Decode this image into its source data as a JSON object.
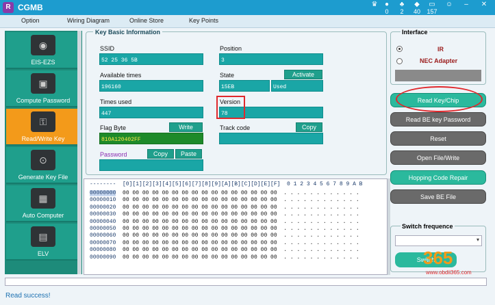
{
  "app": {
    "title": "CGMB",
    "logo_letter": "R"
  },
  "toolbar_icons": [
    {
      "name": "crown-icon",
      "glyph": "♛",
      "count": ""
    },
    {
      "name": "coin-icon",
      "glyph": "●",
      "count": "0"
    },
    {
      "name": "leaf-icon",
      "glyph": "♣",
      "count": "2"
    },
    {
      "name": "diamond-icon",
      "glyph": "◆",
      "count": "40"
    },
    {
      "name": "card-icon",
      "glyph": "▭",
      "count": "157"
    },
    {
      "name": "user-icon",
      "glyph": "☺",
      "count": ""
    },
    {
      "name": "minimize-icon",
      "glyph": "–",
      "count": ""
    },
    {
      "name": "close-icon",
      "glyph": "✕",
      "count": ""
    }
  ],
  "menu": [
    "Option",
    "Wiring Diagram",
    "Online Store",
    "Key Points"
  ],
  "sidebar": [
    {
      "label": "EIS-EZS",
      "icon": "ignition-icon",
      "glyph": "◉",
      "active": false
    },
    {
      "label": "Compute Password",
      "icon": "monitor-icon",
      "glyph": "▣",
      "active": false
    },
    {
      "label": "Read/Write Key",
      "icon": "car-key-icon",
      "glyph": "⚿",
      "active": true
    },
    {
      "label": "Generate Key File",
      "icon": "disc-icon",
      "glyph": "⊙",
      "active": false
    },
    {
      "label": "Auto Computer",
      "icon": "ecu-icon",
      "glyph": "▦",
      "active": false
    },
    {
      "label": "ELV",
      "icon": "elv-icon",
      "glyph": "▤",
      "active": false
    }
  ],
  "keyinfo": {
    "legend": "Key Basic Information",
    "ssid_label": "SSID",
    "ssid_value": "52 25 36 5B",
    "position_label": "Position",
    "position_value": "3",
    "avail_label": "Available times",
    "avail_value": "196160",
    "state_label": "State",
    "state_value": "15EB",
    "state_extra": "Used",
    "activate_label": "Activate",
    "used_label": "Times used",
    "used_value": "447",
    "version_label": "Version",
    "version_value": "78",
    "flag_label": "Flag Byte",
    "flag_value": "810A120402FF",
    "write_label": "Write",
    "track_label": "Track code",
    "track_value": "",
    "copy_label": "Copy",
    "password_label": "Password",
    "password_value": "",
    "pw_copy_label": "Copy",
    "paste_label": "Paste"
  },
  "hex": {
    "header": "--------  [0][1][2][3][4][5][6][7][8][9][A][B][C][D][E][F]  0 1 2 3 4 5 6 7 8 9 A B",
    "rows": [
      {
        "addr": "00000000",
        "bytes": "00 00 00 00 00 00 00 00 00 00 00 00 00 00 00 00",
        "ascii": ". . . . . . . . . . . ."
      },
      {
        "addr": "00000010",
        "bytes": "00 00 00 00 00 00 00 00 00 00 00 00 00 00 00 00",
        "ascii": ". . . . . . . . . . . ."
      },
      {
        "addr": "00000020",
        "bytes": "00 00 00 00 00 00 00 00 00 00 00 00 00 00 00 00",
        "ascii": ". . . . . . . . . . . ."
      },
      {
        "addr": "00000030",
        "bytes": "00 00 00 00 00 00 00 00 00 00 00 00 00 00 00 00",
        "ascii": ". . . . . . . . . . . ."
      },
      {
        "addr": "00000040",
        "bytes": "00 00 00 00 00 00 00 00 00 00 00 00 00 00 00 00",
        "ascii": ". . . . . . . . . . . ."
      },
      {
        "addr": "00000050",
        "bytes": "00 00 00 00 00 00 00 00 00 00 00 00 00 00 00 00",
        "ascii": ". . . . . . . . . . . ."
      },
      {
        "addr": "00000060",
        "bytes": "00 00 00 00 00 00 00 00 00 00 00 00 00 00 00 00",
        "ascii": ". . . . . . . . . . . ."
      },
      {
        "addr": "00000070",
        "bytes": "00 00 00 00 00 00 00 00 00 00 00 00 00 00 00 00",
        "ascii": ". . . . . . . . . . . ."
      },
      {
        "addr": "00000080",
        "bytes": "00 00 00 00 00 00 00 00 00 00 00 00 00 00 00 00",
        "ascii": ". . . . . . . . . . . ."
      },
      {
        "addr": "00000090",
        "bytes": "00 00 00 00 00 00 00 00 00 00 00 00 00 00 00 00",
        "ascii": ". . . . . . . . . . . ."
      }
    ]
  },
  "interface": {
    "legend": "Interface",
    "ir": "IR",
    "nec": "NEC Adapter"
  },
  "buttons": {
    "read_key": "Read Key/Chip",
    "read_be": "Read BE key Password",
    "reset": "Reset",
    "open_file": "Open File/Write",
    "hopping": "Hopping Code Repair",
    "save_be": "Save BE File"
  },
  "switch": {
    "legend": "Switch frequence",
    "button": "Switch"
  },
  "watermark": {
    "brand": "365",
    "site": "www.obdii365.com"
  },
  "status": "Read   success!",
  "colors": {
    "teal": "#1aa6a6",
    "orange": "#f39a1a",
    "titlebar": "#1d9ccf",
    "highlight_red": "#e0282c"
  }
}
